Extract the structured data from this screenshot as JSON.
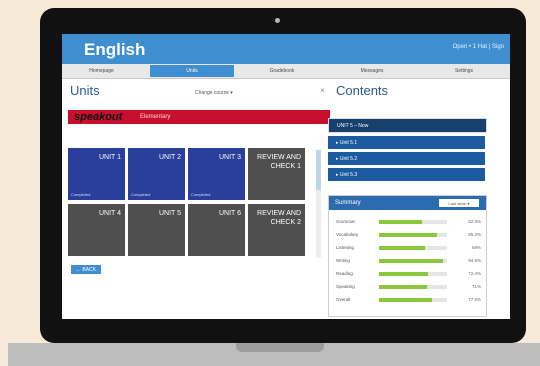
{
  "app": {
    "title": "English",
    "user": "Open • 1 Hat | Sign"
  },
  "nav": [
    {
      "label": "Homepage"
    },
    {
      "label": "Units"
    },
    {
      "label": "Gradebook"
    },
    {
      "label": "Messages"
    },
    {
      "label": "Settings"
    }
  ],
  "units": {
    "title": "Units",
    "filter": "Change course ▾",
    "close": "×",
    "brand": "speakout",
    "level": "Elementary",
    "tiles": [
      {
        "label": "UNIT 1",
        "status": "Completed",
        "color": "blue"
      },
      {
        "label": "UNIT 2",
        "status": "Completed",
        "color": "blue"
      },
      {
        "label": "UNIT 3",
        "status": "Completed",
        "color": "blue"
      },
      {
        "label": "REVIEW AND CHECK 1",
        "status": "",
        "color": "grey"
      },
      {
        "label": "UNIT 4",
        "status": "",
        "color": "grey"
      },
      {
        "label": "UNIT 5",
        "status": "",
        "color": "grey"
      },
      {
        "label": "UNIT 6",
        "status": "",
        "color": "grey"
      },
      {
        "label": "REVIEW AND CHECK 2",
        "status": "",
        "color": "grey"
      }
    ],
    "back": "← BACK"
  },
  "contents": {
    "title": "Contents",
    "header": "UNIT 5 – Now",
    "items": [
      "▸ Unit 5.1",
      "▸ Unit 5.2",
      "▸ Unit 5.3"
    ]
  },
  "summary": {
    "title": "Summary",
    "select": "Last week ▾",
    "skills": [
      {
        "name": "Grammar",
        "pct": "62.5%",
        "value": 0.625
      },
      {
        "name": "Vocabulary",
        "pct": "85.2%",
        "value": 0.852
      },
      {
        "name": "Listening",
        "pct": "68%",
        "value": 0.68
      },
      {
        "name": "Writing",
        "pct": "94.5%",
        "value": 0.945
      },
      {
        "name": "Reading",
        "pct": "72.4%",
        "value": 0.724
      },
      {
        "name": "Speaking",
        "pct": "71%",
        "value": 0.71
      },
      {
        "name": "Overall",
        "pct": "77.5%",
        "value": 0.775
      }
    ]
  }
}
